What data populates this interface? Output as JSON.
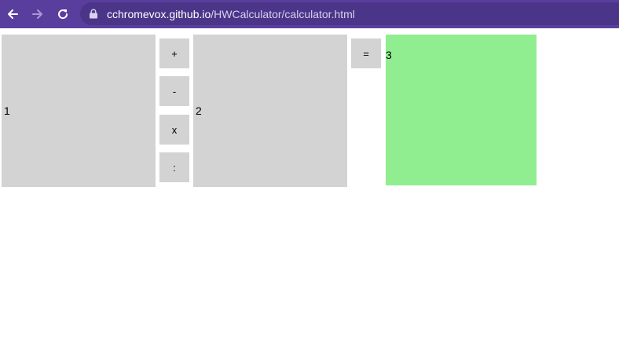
{
  "browser": {
    "url_host": "cchromevox.github.io",
    "url_path": "/HWCalculator/calculator.html",
    "colors": {
      "toolbar": "#5a3e9e",
      "address_bar": "#4a3588"
    }
  },
  "calculator": {
    "operand1": "1",
    "operand2": "2",
    "operators": {
      "add": "+",
      "subtract": "-",
      "multiply": "x",
      "divide": ":"
    },
    "equals_label": "=",
    "result": "3",
    "colors": {
      "field": "#d3d3d3",
      "result": "#90ee90"
    }
  }
}
